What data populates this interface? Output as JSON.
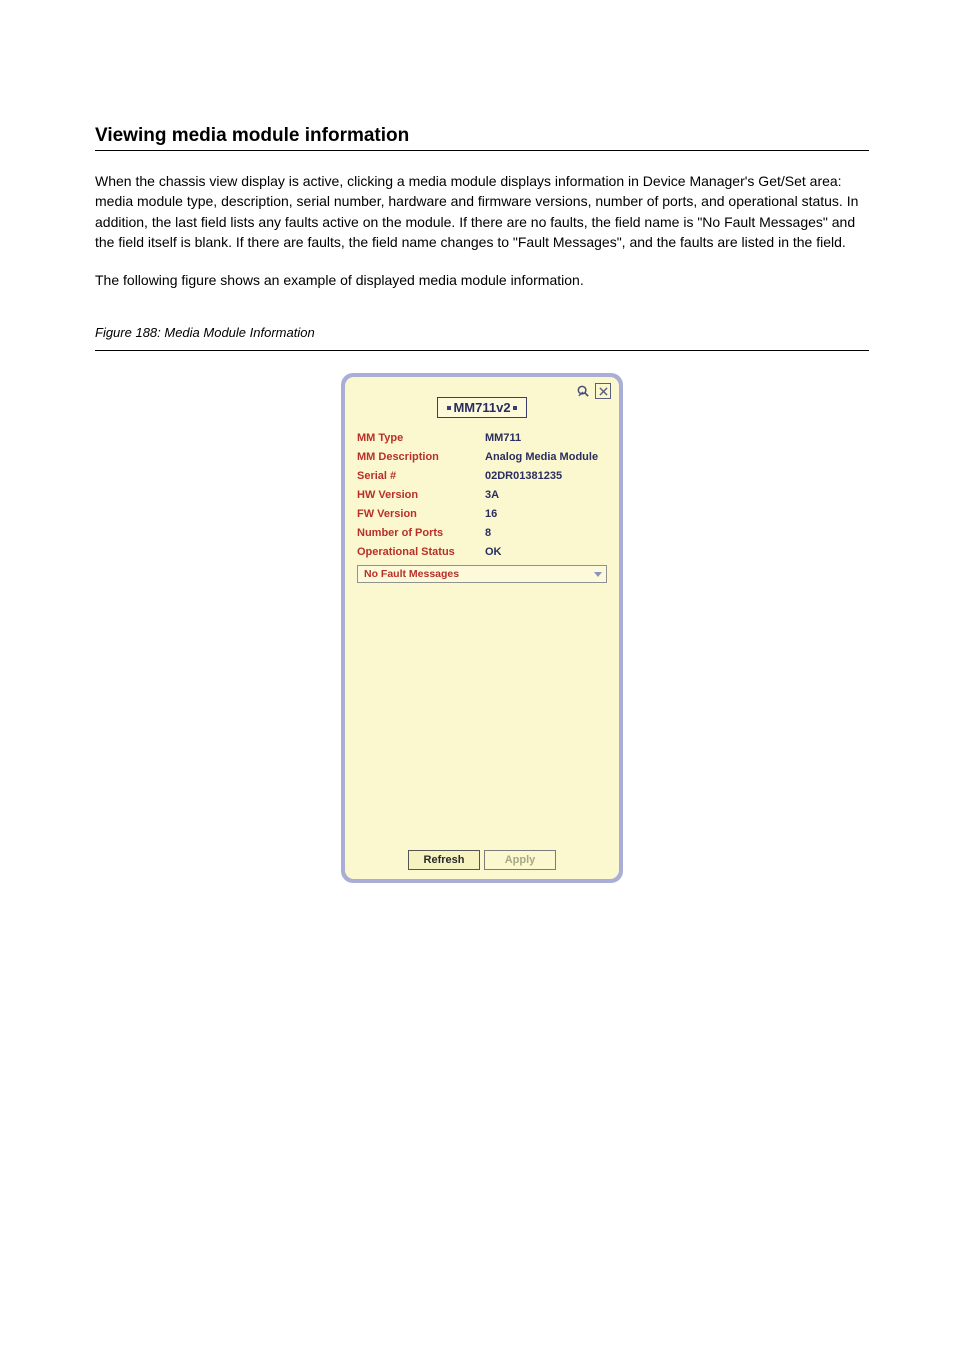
{
  "headingText": "Viewing media module information",
  "paragraphs": [
    "When the chassis view display is active, clicking a media module displays information in Device Manager's Get/Set area: media module type, description, serial number, hardware and firmware versions, number of ports, and operational status. In addition, the last field lists any faults active on the module. If there are no faults, the field name is \"No Fault Messages\" and the field itself is blank. If there are faults, the field name changes to \"Fault Messages\", and the faults are listed in the field.",
    "The following figure shows an example of displayed media module information."
  ],
  "figureCaption": "Figure 188: Media Module Information",
  "panel": {
    "title": "MM711v2",
    "rows": [
      {
        "label": "MM Type",
        "value": "MM711"
      },
      {
        "label": "MM Description",
        "value": "Analog Media Module"
      },
      {
        "label": "Serial #",
        "value": "02DR01381235"
      },
      {
        "label": "HW Version",
        "value": "3A"
      },
      {
        "label": "FW Version",
        "value": "16"
      },
      {
        "label": "Number of Ports",
        "value": "8"
      },
      {
        "label": "Operational Status",
        "value": "OK"
      }
    ],
    "dropdownLabel": "No Fault Messages",
    "buttons": {
      "refresh": "Refresh",
      "apply": "Apply"
    }
  }
}
